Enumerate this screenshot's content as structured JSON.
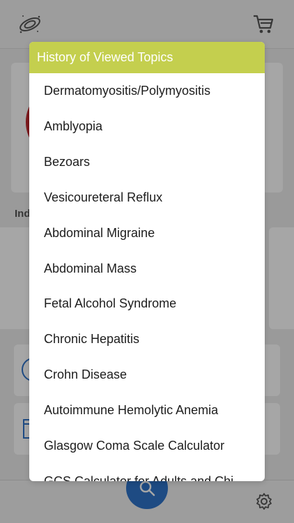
{
  "modal": {
    "title": "History of Viewed Topics",
    "topics": [
      "Dermatomyositis/Polymyositis",
      "Amblyopia",
      "Bezoars",
      "Vesicoureteral Reflux",
      "Abdominal Migraine",
      "Abdominal Mass",
      "Fetal Alcohol Syndrome",
      "Chronic Hepatitis",
      "Crohn Disease",
      "Autoimmune Hemolytic Anemia",
      "Glasgow Coma Scale Calculator",
      "GCS Calculator for Adults and Chi"
    ]
  },
  "background": {
    "section_label": "Ind"
  },
  "colors": {
    "header_accent": "#c4cf4e",
    "fab_blue": "#2f73c9",
    "icon_blue": "#2f73c9",
    "emblem_red": "#c0272d"
  },
  "icons": {
    "logo": "app-logo-icon",
    "cart": "cart-icon",
    "search": "search-icon",
    "settings": "gear-icon"
  }
}
